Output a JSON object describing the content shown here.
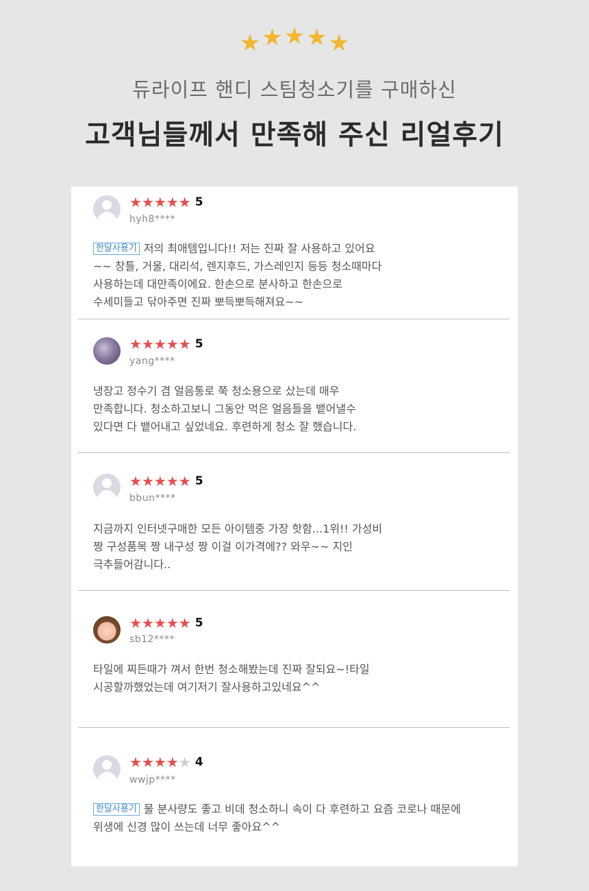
{
  "header": {
    "stars": [
      "★",
      "★",
      "★",
      "★",
      "★"
    ],
    "subtitle": "듀라이프 핸디 스팀청소기를 구매하신",
    "title": "고객님들께서 만족해 주신 리얼후기"
  },
  "colors": {
    "gold_star": "#f1b72f",
    "red_star": "#e84d4f",
    "tag_blue": "#3d86c6"
  },
  "reviews": [
    {
      "rating": 5,
      "rating_label": "5",
      "user": "hyh8****",
      "avatar": "default-avatar-icon",
      "tag": "한달사용기",
      "lines": [
        "저의 최애템입니다!! 저는 진짜 잘 사용하고 있어요",
        "~~ 창틀, 거울, 대리석, 렌지후드, 가스레인지 등등 청소때마다",
        "사용하는데 대만족이에요. 한손으로 분사하고 한손으로",
        "수세미들고 닦아주면 진짜 뽀득뽀득해져요~~"
      ]
    },
    {
      "rating": 5,
      "rating_label": "5",
      "user": "yang****",
      "avatar": "photo-avatar",
      "tag": "",
      "lines": [
        "냉장고 정수기 겸 얼음통로 쭉 청소용으로 샀는데 매우",
        "만족합니다. 청소하고보니 그동안 먹은 얼음들을 뱉어낼수",
        "있다면 다 뱉어내고 싶었네요. 후련하게 청소 잘 했습니다."
      ]
    },
    {
      "rating": 5,
      "rating_label": "5",
      "user": "bbun****",
      "avatar": "default-avatar-icon",
      "tag": "",
      "lines": [
        "지금까지 인터넷구매한 모든 아이템중 가장 핫함...1위!! 가성비",
        "짱 구성품목 짱 내구성 짱 이걸 이가격에?? 와우~~ 지인",
        "극추들어감니다.."
      ]
    },
    {
      "rating": 5,
      "rating_label": "5",
      "user": "sb12****",
      "avatar": "photo-avatar",
      "tag": "",
      "lines": [
        "타일에 찌든때가 껴서 한번 청소해봤는데 진짜 잘되요~!타일",
        "시공할까했었는데 여기저기 잘사용하고있네요^^"
      ]
    },
    {
      "rating": 4,
      "rating_label": "4",
      "user": "wwjp****",
      "avatar": "default-avatar-icon",
      "tag": "한달사용기",
      "lines": [
        "물 분사량도 좋고 비데 청소하니 속이 다 후련하고 요즘 코로나 때문에",
        "위생에 신경 많이 쓰는데 너무 좋아요^^"
      ]
    }
  ]
}
